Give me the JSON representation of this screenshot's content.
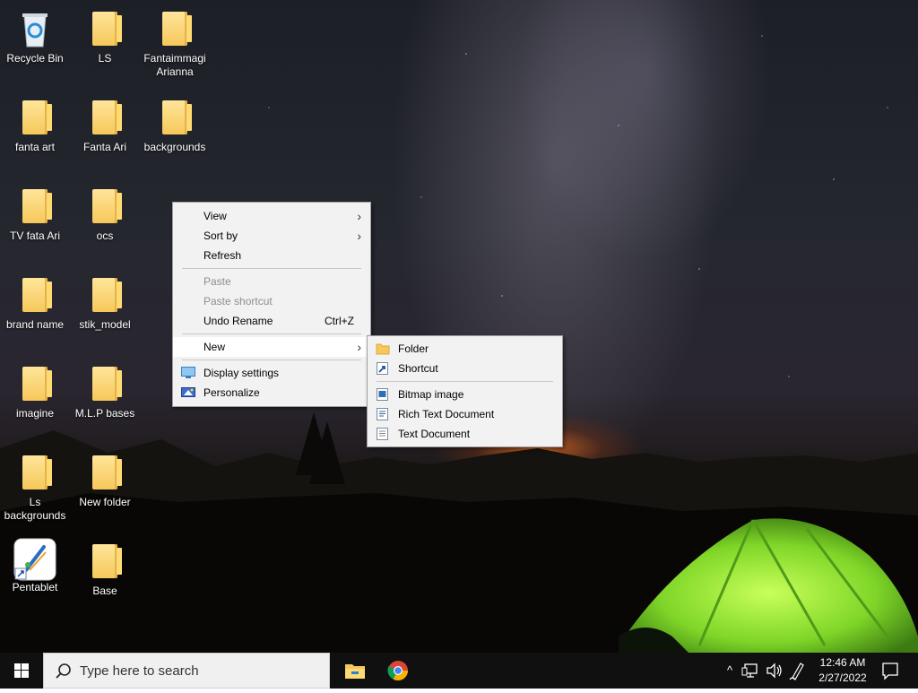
{
  "desktop": {
    "icons": [
      {
        "label": "Recycle Bin",
        "type": "recycle-bin"
      },
      {
        "label": "LS",
        "type": "folder"
      },
      {
        "label": "Fantaimmagi Arianna",
        "type": "folder"
      },
      {
        "label": "fanta art",
        "type": "folder"
      },
      {
        "label": "Fanta Ari",
        "type": "folder"
      },
      {
        "label": "backgrounds",
        "type": "folder"
      },
      {
        "label": "TV  fata Ari",
        "type": "folder"
      },
      {
        "label": "ocs",
        "type": "folder"
      },
      {
        "label": "brand name",
        "type": "folder"
      },
      {
        "label": "stik_model",
        "type": "folder"
      },
      {
        "label": "imagine",
        "type": "folder"
      },
      {
        "label": "M.L.P bases",
        "type": "folder"
      },
      {
        "label": "Ls backgrounds",
        "type": "folder"
      },
      {
        "label": "New folder",
        "type": "folder"
      },
      {
        "label": "Pentablet",
        "type": "app-shortcut"
      },
      {
        "label": "Base",
        "type": "folder"
      }
    ]
  },
  "context_menu": {
    "items": [
      {
        "label": "View",
        "submenu": true
      },
      {
        "label": "Sort by",
        "submenu": true
      },
      {
        "label": "Refresh"
      },
      {
        "label": "Paste",
        "disabled": true
      },
      {
        "label": "Paste shortcut",
        "disabled": true
      },
      {
        "label": "Undo Rename",
        "shortcut": "Ctrl+Z"
      },
      {
        "label": "New",
        "submenu": true,
        "highlighted": true
      },
      {
        "label": "Display settings",
        "icon": "display-icon"
      },
      {
        "label": "Personalize",
        "icon": "personalize-icon"
      }
    ],
    "arrow": "›"
  },
  "new_submenu": {
    "items": [
      {
        "label": "Folder",
        "icon": "folder-icon"
      },
      {
        "label": "Shortcut",
        "icon": "shortcut-icon"
      },
      {
        "label": "Bitmap image",
        "icon": "bitmap-icon"
      },
      {
        "label": "Rich Text Document",
        "icon": "rich-text-icon"
      },
      {
        "label": "Text Document",
        "icon": "text-document-icon"
      }
    ]
  },
  "taskbar": {
    "search_placeholder": "Type here to search",
    "pinned": [
      "file-explorer-icon",
      "chrome-icon"
    ],
    "clock_time": "12:46 AM",
    "clock_date": "2/27/2022",
    "tray_chevron": "^"
  },
  "colors": {
    "taskbar": "#101010",
    "menu_bg": "#f2f2f2",
    "menu_hover": "#ffffff",
    "menu_disabled": "#8d8d8d",
    "folder": "#f6c85a"
  }
}
